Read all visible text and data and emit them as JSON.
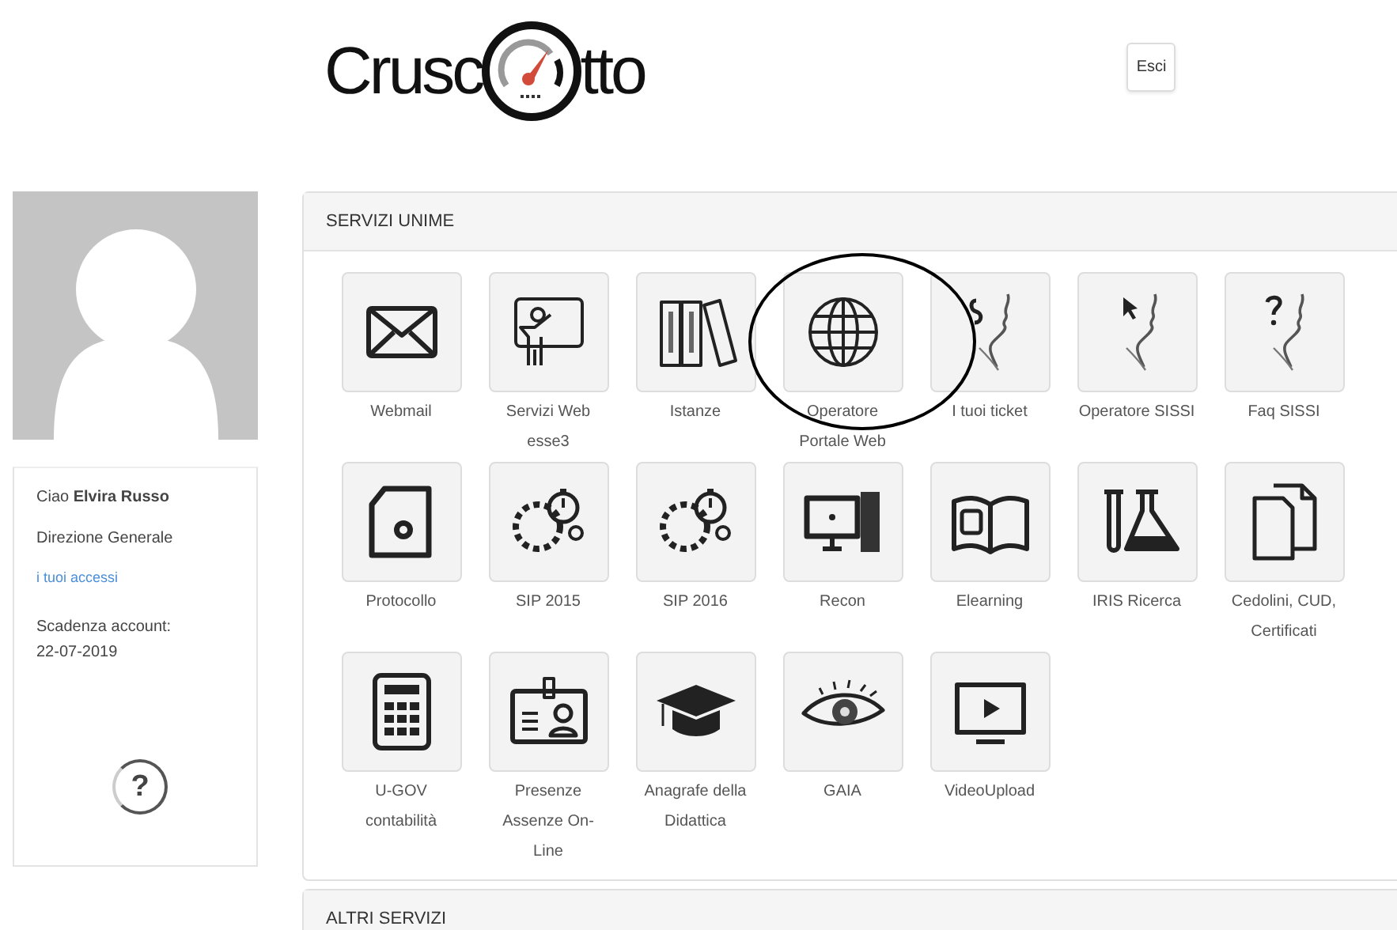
{
  "header": {
    "logo": {
      "left": "Crusc",
      "right": "tto"
    },
    "logout_button": "Esci"
  },
  "sidebar": {
    "greeting": "Ciao **Elvira Russo**",
    "department": "Direzione Generale",
    "access_link": "i tuoi accessi",
    "expiry_label": "Scadenza account:",
    "expiry_date": "22-07-2019",
    "help": "?"
  },
  "sections": [
    {
      "title": "SERVIZI UNIME",
      "services": [
        {
          "label": "Webmail"
        },
        {
          "label": "Servizi Web esse3"
        },
        {
          "label": "Istanze"
        },
        {
          "label": "Operatore Portale Web"
        },
        {
          "label": "I tuoi ticket"
        },
        {
          "label": "Operatore SISSI"
        },
        {
          "label": "Faq SISSI"
        },
        {
          "label": "Protocollo"
        },
        {
          "label": "SIP 2015"
        },
        {
          "label": "SIP 2016"
        },
        {
          "label": "Recon"
        },
        {
          "label": "Elearning"
        },
        {
          "label": "IRIS Ricerca"
        },
        {
          "label": "Cedolini, CUD, Certificati"
        },
        {
          "label": "U-GOV contabilità"
        },
        {
          "label": "Presenze Assenze On-Line"
        },
        {
          "label": "Anagrafe della Didattica"
        },
        {
          "label": "GAIA"
        },
        {
          "label": "VideoUpload"
        }
      ]
    },
    {
      "title": "ALTRI SERVIZI"
    }
  ]
}
